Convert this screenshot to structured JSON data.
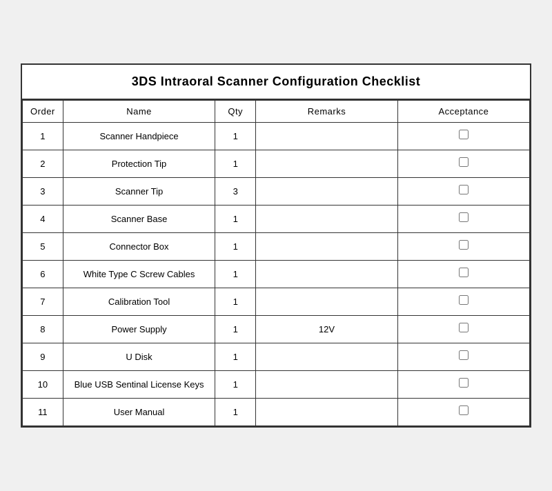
{
  "title": "3DS Intraoral Scanner Configuration Checklist",
  "headers": {
    "order": "Order",
    "name": "Name",
    "qty": "Qty",
    "remarks": "Remarks",
    "acceptance": "Acceptance"
  },
  "rows": [
    {
      "order": "1",
      "name": "Scanner Handpiece",
      "qty": "1",
      "remarks": "",
      "acceptance": "☐"
    },
    {
      "order": "2",
      "name": "Protection Tip",
      "qty": "1",
      "remarks": "",
      "acceptance": "☐"
    },
    {
      "order": "3",
      "name": "Scanner Tip",
      "qty": "3",
      "remarks": "",
      "acceptance": "☐"
    },
    {
      "order": "4",
      "name": "Scanner Base",
      "qty": "1",
      "remarks": "",
      "acceptance": "☐"
    },
    {
      "order": "5",
      "name": "Connector Box",
      "qty": "1",
      "remarks": "",
      "acceptance": "☐"
    },
    {
      "order": "6",
      "name": "White Type C Screw Cables",
      "qty": "1",
      "remarks": "",
      "acceptance": "☐"
    },
    {
      "order": "7",
      "name": "Calibration Tool",
      "qty": "1",
      "remarks": "",
      "acceptance": "☐"
    },
    {
      "order": "8",
      "name": "Power Supply",
      "qty": "1",
      "remarks": "12V",
      "acceptance": "☐"
    },
    {
      "order": "9",
      "name": "U Disk",
      "qty": "1",
      "remarks": "",
      "acceptance": "☐"
    },
    {
      "order": "10",
      "name": "Blue USB Sentinal License Keys",
      "qty": "1",
      "remarks": "",
      "acceptance": "☐"
    },
    {
      "order": "11",
      "name": "User Manual",
      "qty": "1",
      "remarks": "",
      "acceptance": "☐"
    }
  ]
}
